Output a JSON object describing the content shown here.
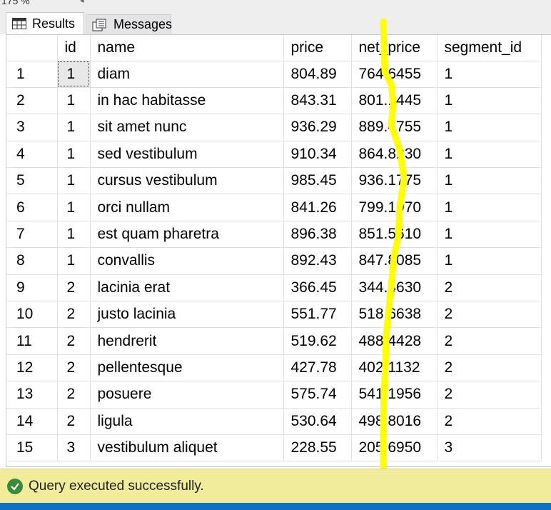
{
  "zoom": {
    "label": "175 %"
  },
  "tabs": {
    "results": "Results",
    "messages": "Messages"
  },
  "grid": {
    "columns": [
      "",
      "id",
      "name",
      "price",
      "net_price",
      "segment_id"
    ],
    "rows": [
      [
        "1",
        "1",
        "diam",
        "804.89",
        "764.6455",
        "1"
      ],
      [
        "2",
        "1",
        "in hac habitasse",
        "843.31",
        "801.1445",
        "1"
      ],
      [
        "3",
        "1",
        "sit amet nunc",
        "936.29",
        "889.4755",
        "1"
      ],
      [
        "4",
        "1",
        "sed vestibulum",
        "910.34",
        "864.8230",
        "1"
      ],
      [
        "5",
        "1",
        "cursus vestibulum",
        "985.45",
        "936.1775",
        "1"
      ],
      [
        "6",
        "1",
        "orci nullam",
        "841.26",
        "799.1970",
        "1"
      ],
      [
        "7",
        "1",
        "est quam pharetra",
        "896.38",
        "851.5610",
        "1"
      ],
      [
        "8",
        "1",
        "convallis",
        "892.43",
        "847.8085",
        "1"
      ],
      [
        "9",
        "2",
        "lacinia erat",
        "366.45",
        "344.4630",
        "2"
      ],
      [
        "10",
        "2",
        "justo lacinia",
        "551.77",
        "518.6638",
        "2"
      ],
      [
        "11",
        "2",
        "hendrerit",
        "519.62",
        "488.4428",
        "2"
      ],
      [
        "12",
        "2",
        "pellentesque",
        "427.78",
        "402.1132",
        "2"
      ],
      [
        "13",
        "2",
        "posuere",
        "575.74",
        "541.1956",
        "2"
      ],
      [
        "14",
        "2",
        "ligula",
        "530.64",
        "498.8016",
        "2"
      ],
      [
        "15",
        "3",
        "vestibulum aliquet",
        "228.55",
        "205.6950",
        "3"
      ]
    ]
  },
  "status": {
    "message": "Query executed successfully."
  },
  "colors": {
    "highlight": "#ffff00",
    "status_bg": "#f1ec9b",
    "accent": "#0e72c4"
  }
}
